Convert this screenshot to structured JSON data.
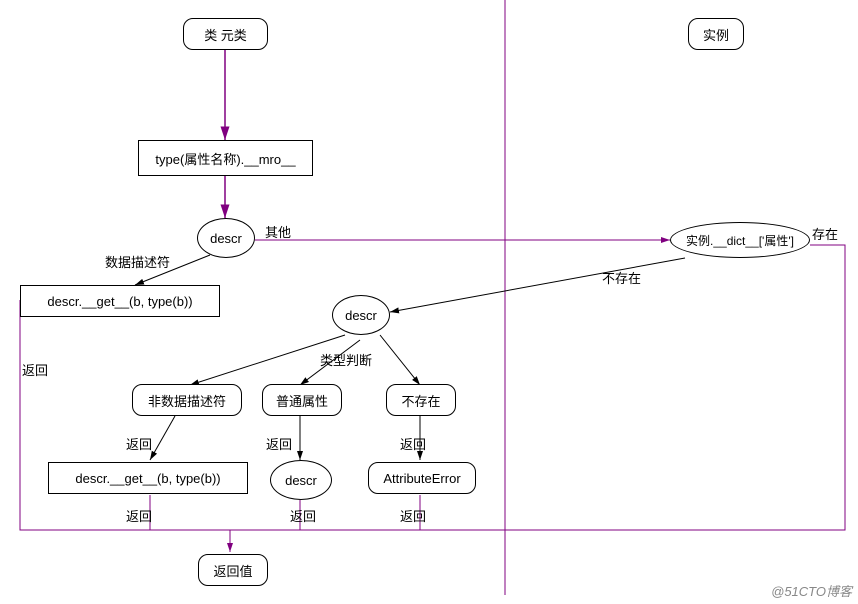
{
  "nodes": {
    "class_metaclass": "类    元类",
    "instance": "实例",
    "type_mro": "type(属性名称).__mro__",
    "descr1": "descr",
    "descr2": "descr",
    "descr3": "descr",
    "instance_dict": "实例.__dict__['属性']",
    "get1": "descr.__get__(b, type(b))",
    "get2": "descr.__get__(b, type(b))",
    "non_data_descr": "非数据描述符",
    "normal_attr": "普通属性",
    "not_exist": "不存在",
    "attribute_error": "AttributeError",
    "return_value": "返回值"
  },
  "labels": {
    "data_descr": "数据描述符",
    "other": "其他",
    "exist": "存在",
    "not_exist": "不存在",
    "type_check": "类型判断",
    "return": "返回"
  },
  "watermark": "@51CTO博客",
  "colors": {
    "purple": "#800080"
  }
}
